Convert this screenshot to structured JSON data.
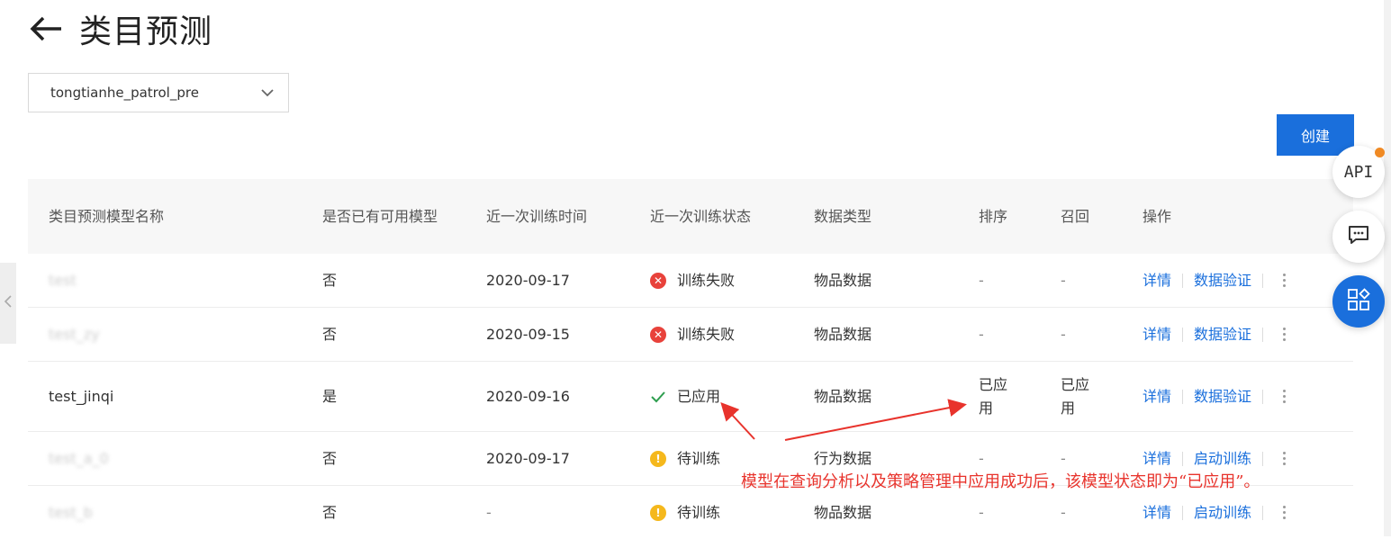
{
  "header": {
    "title": "类目预测"
  },
  "project_select": {
    "value": "tongtianhe_patrol_pre"
  },
  "toolbar": {
    "create_label": "创建"
  },
  "table": {
    "columns": [
      "类目预测模型名称",
      "是否已有可用模型",
      "近一次训练时间",
      "近一次训练状态",
      "数据类型",
      "排序",
      "召回",
      "操作"
    ],
    "rows": [
      {
        "name": "test",
        "has_model": "否",
        "train_time": "2020-09-17",
        "status": "训练失败",
        "status_type": "fail",
        "data_type": "物品数据",
        "sort": "-",
        "recall": "-",
        "action1": "详情",
        "action2": "数据验证"
      },
      {
        "name": "test_zy",
        "has_model": "否",
        "train_time": "2020-09-15",
        "status": "训练失败",
        "status_type": "fail",
        "data_type": "物品数据",
        "sort": "-",
        "recall": "-",
        "action1": "详情",
        "action2": "数据验证"
      },
      {
        "name": "test_jinqi",
        "has_model": "是",
        "train_time": "2020-09-16",
        "status": "已应用",
        "status_type": "ok",
        "data_type": "物品数据",
        "sort": "已应用",
        "recall": "已应用",
        "action1": "详情",
        "action2": "数据验证"
      },
      {
        "name": "test_a_0",
        "has_model": "否",
        "train_time": "2020-09-17",
        "status": "待训练",
        "status_type": "warn",
        "data_type": "行为数据",
        "sort": "-",
        "recall": "-",
        "action1": "详情",
        "action2": "启动训练"
      },
      {
        "name": "test_b",
        "has_model": "否",
        "train_time": "-",
        "status": "待训练",
        "status_type": "warn",
        "data_type": "物品数据",
        "sort": "-",
        "recall": "-",
        "action1": "详情",
        "action2": "启动训练"
      }
    ]
  },
  "float_buttons": {
    "api_label": "API",
    "api_badge_color": "#f08a24"
  },
  "annotation": {
    "text": "模型在查询分析以及策略管理中应用成功后，该模型状态即为“已应用”。",
    "color": "#e8332c"
  },
  "icons": [
    "back-arrow-icon",
    "chevron-down-icon",
    "fail-icon",
    "check-icon",
    "warning-icon",
    "more-icon",
    "chat-icon",
    "apps-icon",
    "chevron-left-icon"
  ],
  "colors": {
    "primary": "#1a6fdc",
    "fail": "#e8423b",
    "warn": "#f5b81c",
    "success": "#2e9e4f"
  }
}
